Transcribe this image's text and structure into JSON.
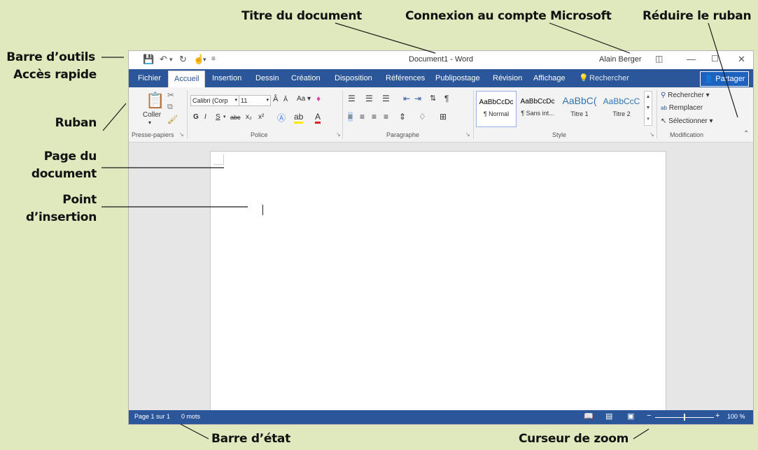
{
  "callouts": {
    "titre_document": "Titre du document",
    "connexion": "Connexion au compte Microsoft",
    "reduire_ruban": "Réduire le ruban",
    "barre_outils_l1": "Barre d’outils",
    "barre_outils_l2": "Accès rapide",
    "ruban": "Ruban",
    "page_l1": "Page du",
    "page_l2": "document",
    "point_l1": "Point",
    "point_l2": "d’insertion",
    "barre_etat": "Barre d’état",
    "curseur_zoom": "Curseur de zoom"
  },
  "window": {
    "title": "Document1 - Word",
    "user": "Alain Berger",
    "qat_icons": [
      "save-icon",
      "undo-icon",
      "redo-icon",
      "touch-mode-icon",
      "customize-qat-icon"
    ]
  },
  "tabs": {
    "fichier": "Fichier",
    "accueil": "Accueil",
    "insertion": "Insertion",
    "dessin": "Dessin",
    "creation": "Création",
    "disposition": "Disposition",
    "references": "Références",
    "publipostage": "Publipostage",
    "revision": "Révision",
    "affichage": "Affichage",
    "rechercher": "Rechercher",
    "partager": "Partager"
  },
  "ribbon": {
    "clipboard": {
      "coller": "Coller",
      "label": "Presse-papiers"
    },
    "font": {
      "name": "Calibri (Corp",
      "size": "11",
      "case_btn": "Aa",
      "bold": "G",
      "italic": "I",
      "underline": "S",
      "strike": "abc",
      "sub": "x₂",
      "sup": "x²",
      "label": "Police"
    },
    "paragraph": {
      "label": "Paragraphe"
    },
    "styles": {
      "items": [
        {
          "preview": "AaBbCcDc",
          "name": "¶ Normal"
        },
        {
          "preview": "AaBbCcDc",
          "name": "¶ Sans int..."
        },
        {
          "preview": "AaBbC(",
          "name": "Titre 1"
        },
        {
          "preview": "AaBbCcC",
          "name": "Titre 2"
        }
      ],
      "label": "Style"
    },
    "editing": {
      "rechercher": "Rechercher",
      "remplacer": "Remplacer",
      "selectionner": "Sélectionner",
      "label": "Modification"
    }
  },
  "status": {
    "page": "Page 1 sur 1",
    "words": "0 mots",
    "zoom": "100 %",
    "zoom_value": 100
  },
  "colors": {
    "accent": "#2b579a",
    "background": "#dfe9bd"
  }
}
